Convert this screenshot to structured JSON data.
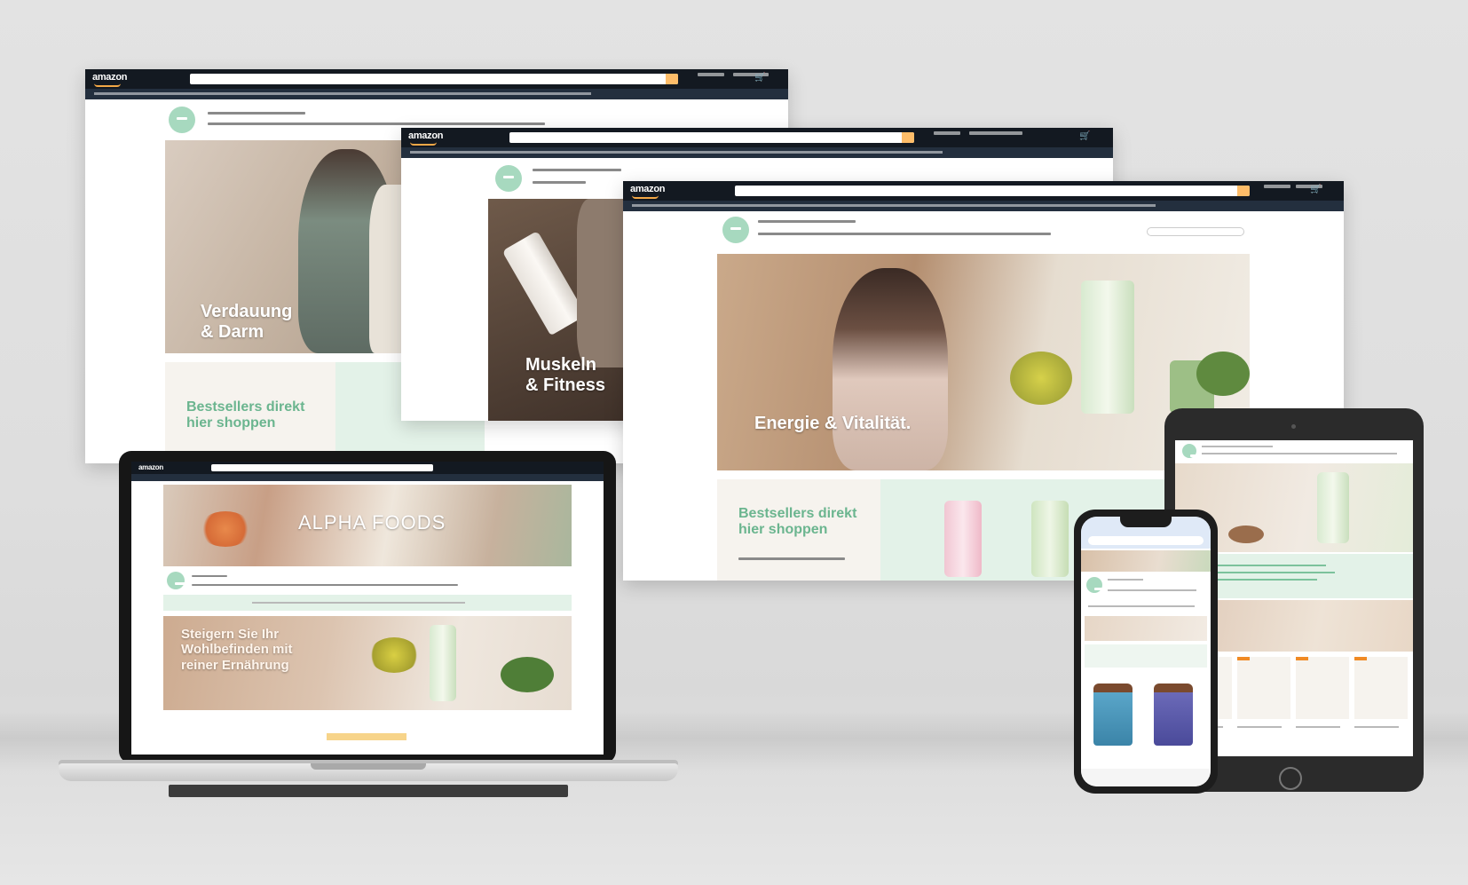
{
  "scene": {
    "background_color": "#e0e0e0",
    "devices": [
      "desktop-screenshot",
      "desktop-screenshot",
      "desktop-screenshot",
      "laptop",
      "tablet",
      "smartphone"
    ]
  },
  "colors": {
    "amazon_header": "#131921",
    "amazon_subnav": "#232f3e",
    "amazon_accent": "#febd69",
    "brand_green": "#6bb58f",
    "brand_mint": "#e3f2e8"
  },
  "panel_back": {
    "logo": "amazon",
    "hero_title_line1": "Verdauung",
    "hero_title_line2": "& Darm",
    "promo_line1": "Bestsellers direkt",
    "promo_line2": "hier shoppen"
  },
  "panel_middle": {
    "logo": "amazon",
    "hero_title_line1": "Muskeln",
    "hero_title_line2": "& Fitness"
  },
  "panel_front": {
    "logo": "amazon",
    "hero_title": "Energie & Vitalität.",
    "promo_line1": "Bestsellers direkt",
    "promo_line2": "hier shoppen"
  },
  "laptop": {
    "logo": "amazon",
    "banner_title": "ALPHA FOODS",
    "headline_line1": "Steigern Sie Ihr",
    "headline_line2": "Wohlbefinden mit",
    "headline_line3": "reiner Ernährung"
  },
  "icons": {
    "cart": "cart-icon",
    "search": "search-icon",
    "brand": "brand-logo-icon",
    "home_button": "home-button-icon"
  }
}
